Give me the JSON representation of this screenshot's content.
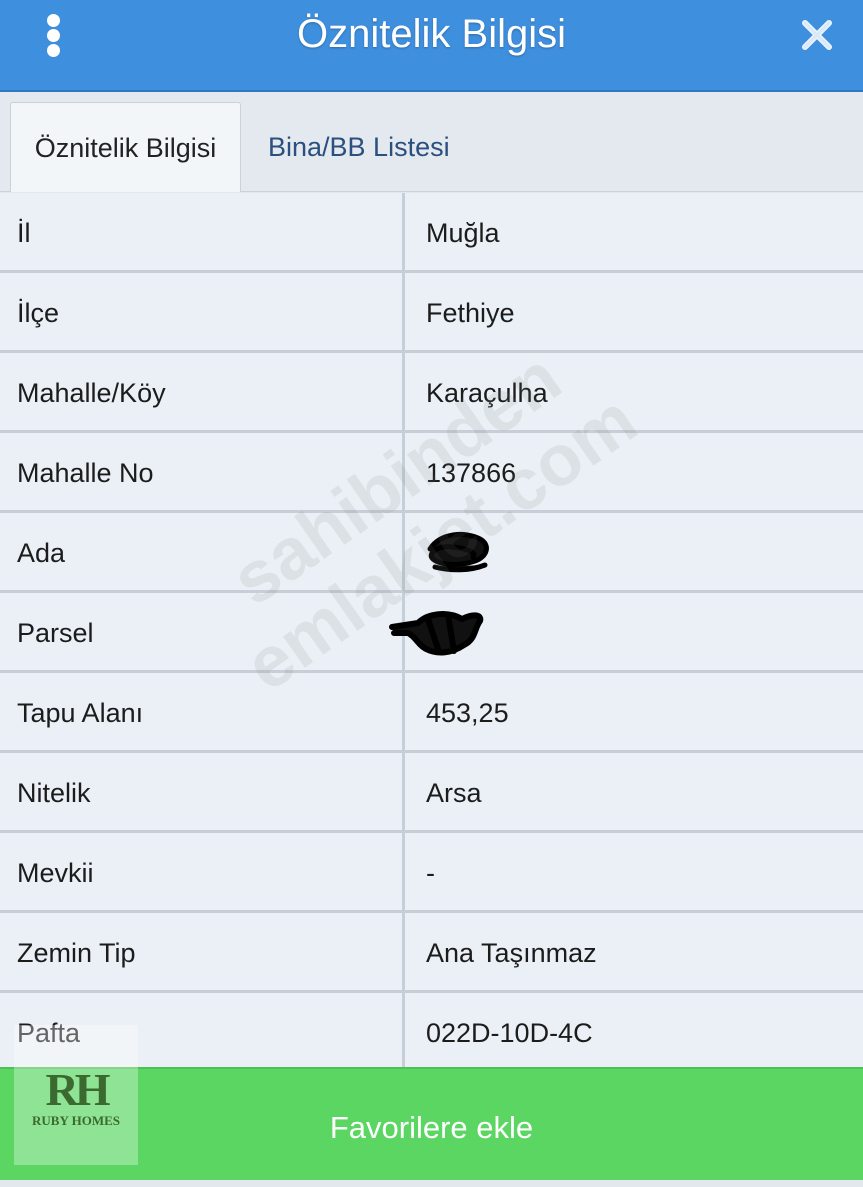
{
  "header": {
    "title": "Öznitelik Bilgisi",
    "menu_icon": "more-vertical-icon",
    "close_icon": "close-icon",
    "color": "#3f8fdf"
  },
  "tabs": [
    {
      "label": "Öznitelik Bilgisi",
      "active": true
    },
    {
      "label": "Bina/BB Listesi",
      "active": false
    }
  ],
  "rows": [
    {
      "label": "İl",
      "value": "Muğla"
    },
    {
      "label": "İlçe",
      "value": "Fethiye"
    },
    {
      "label": "Mahalle/Köy",
      "value": "Karaçulha"
    },
    {
      "label": "Mahalle No",
      "value": "137866"
    },
    {
      "label": "Ada",
      "value": ""
    },
    {
      "label": "Parsel",
      "value": ""
    },
    {
      "label": "Tapu Alanı",
      "value": "453,25"
    },
    {
      "label": "Nitelik",
      "value": "Arsa"
    },
    {
      "label": "Mevkii",
      "value": "-"
    },
    {
      "label": "Zemin Tip",
      "value": "Ana Taşınmaz"
    },
    {
      "label": "Pafta",
      "value": "022D-10D-4C"
    }
  ],
  "footer": {
    "button_label": "Favorilere ekle",
    "color": "#5bd662"
  },
  "logo": {
    "mark": "RH",
    "text": "RUBY HOMES"
  },
  "watermark": {
    "line1": "sahibinden",
    "line2": "emlakjet.com"
  }
}
